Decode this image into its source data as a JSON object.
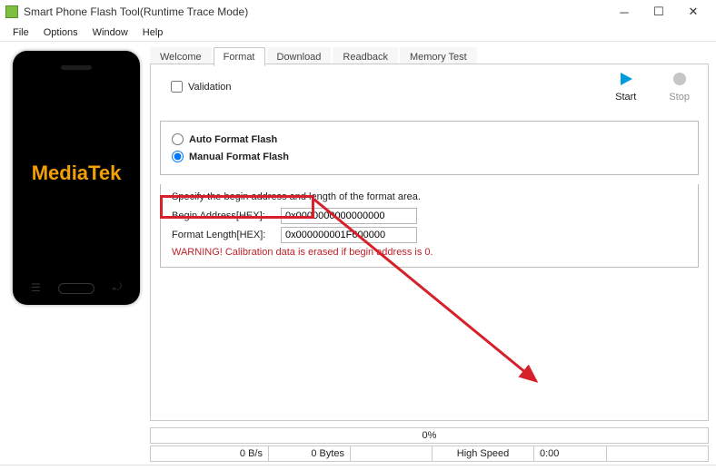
{
  "window": {
    "title": "Smart Phone Flash Tool(Runtime Trace Mode)"
  },
  "menu": {
    "file": "File",
    "options": "Options",
    "window": "Window",
    "help": "Help"
  },
  "phone": {
    "brand": "MediaTek"
  },
  "tabs": {
    "items": [
      {
        "label": "Welcome"
      },
      {
        "label": "Format"
      },
      {
        "label": "Download"
      },
      {
        "label": "Readback"
      },
      {
        "label": "Memory Test"
      }
    ],
    "active_index": 1
  },
  "format_tab": {
    "validation_label": "Validation",
    "validation_checked": false,
    "actions": {
      "start_label": "Start",
      "stop_label": "Stop"
    },
    "radios": {
      "auto_label": "Auto Format Flash",
      "manual_label": "Manual Format Flash",
      "selected": "manual"
    },
    "form": {
      "desc": "Specify the begin address and length of the format area.",
      "begin_label": "Begin Address[HEX]:",
      "begin_value": "0x0000000000000000",
      "length_label": "Format Length[HEX]:",
      "length_value": "0x000000001F600000",
      "warning": "WARNING! Calibration data is erased if begin address is 0."
    }
  },
  "progress": {
    "percent_text": "0%"
  },
  "status": {
    "rate": "0 B/s",
    "bytes": "0 Bytes",
    "speed": "High Speed",
    "time": "0:00"
  }
}
